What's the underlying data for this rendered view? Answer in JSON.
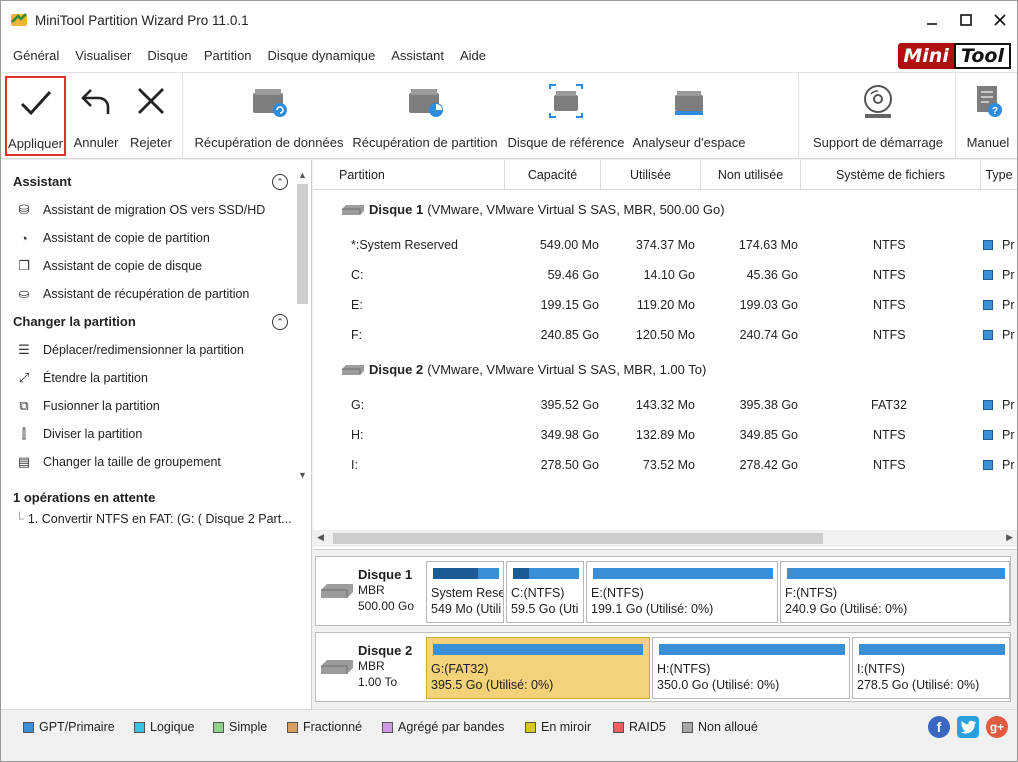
{
  "window": {
    "title": "MiniTool Partition Wizard Pro 11.0.1"
  },
  "logo": {
    "part1": "Mini",
    "part2": "Tool"
  },
  "menu": [
    "Général",
    "Visualiser",
    "Disque",
    "Partition",
    "Disque dynamique",
    "Assistant",
    "Aide"
  ],
  "toolbar": {
    "apply": "Appliquer",
    "undo": "Annuler",
    "discard": "Rejeter",
    "data_recovery": "Récupération de données",
    "partition_recovery": "Récupération de partition",
    "benchmark": "Disque de référence",
    "space_analyzer": "Analyseur d'espace",
    "bootable_media": "Support de démarrage",
    "manual": "Manuel"
  },
  "sidebar": {
    "wizard_head": "Assistant",
    "wizard_items": [
      "Assistant de migration OS vers SSD/HD",
      "Assistant de copie de partition",
      "Assistant de copie de disque",
      "Assistant de récupération de partition"
    ],
    "change_head": "Changer la partition",
    "change_items": [
      "Déplacer/redimensionner la partition",
      "Étendre la partition",
      "Fusionner la partition",
      "Diviser la partition",
      "Changer la taille de groupement"
    ],
    "pending_head": "1 opérations en attente",
    "pending_items": [
      "1. Convertir NTFS en FAT: (G: ( Disque 2 Part..."
    ]
  },
  "table": {
    "columns": [
      "Partition",
      "Capacité",
      "Utilisée",
      "Non utilisée",
      "Système de fichiers",
      "Type"
    ],
    "disk1": {
      "name": "Disque 1",
      "desc": "(VMware, VMware Virtual S SAS, MBR, 500.00 Go)"
    },
    "disk1_rows": [
      {
        "partition": "*:System Reserved",
        "capacity": "549.00 Mo",
        "used": "374.37 Mo",
        "unused": "174.63 Mo",
        "fs": "NTFS",
        "type": "Pr"
      },
      {
        "partition": "C:",
        "capacity": "59.46 Go",
        "used": "14.10 Go",
        "unused": "45.36 Go",
        "fs": "NTFS",
        "type": "Pr"
      },
      {
        "partition": "E:",
        "capacity": "199.15 Go",
        "used": "119.20 Mo",
        "unused": "199.03 Go",
        "fs": "NTFS",
        "type": "Pr"
      },
      {
        "partition": "F:",
        "capacity": "240.85 Go",
        "used": "120.50 Mo",
        "unused": "240.74 Go",
        "fs": "NTFS",
        "type": "Pr"
      }
    ],
    "disk2": {
      "name": "Disque 2",
      "desc": "(VMware, VMware Virtual S SAS, MBR, 1.00 To)"
    },
    "disk2_rows": [
      {
        "partition": "G:",
        "capacity": "395.52 Go",
        "used": "143.32 Mo",
        "unused": "395.38 Go",
        "fs": "FAT32",
        "type": "Pr"
      },
      {
        "partition": "H:",
        "capacity": "349.98 Go",
        "used": "132.89 Mo",
        "unused": "349.85 Go",
        "fs": "NTFS",
        "type": "Pr"
      },
      {
        "partition": "I:",
        "capacity": "278.50 Go",
        "used": "73.52 Mo",
        "unused": "278.42 Go",
        "fs": "NTFS",
        "type": "Pr"
      }
    ]
  },
  "diskmap": {
    "disk1": {
      "name": "Disque 1",
      "type": "MBR",
      "size": "500.00 Go",
      "parts": [
        {
          "l1": "System Rese",
          "l2": "549 Mo (Utili",
          "used": 0.68
        },
        {
          "l1": "C:(NTFS)",
          "l2": "59.5 Go (Uti",
          "used": 0.24
        },
        {
          "l1": "E:(NTFS)",
          "l2": "199.1 Go (Utilisé: 0%)",
          "used": 0.0
        },
        {
          "l1": "F:(NTFS)",
          "l2": "240.9 Go (Utilisé: 0%)",
          "used": 0.0
        }
      ]
    },
    "disk2": {
      "name": "Disque 2",
      "type": "MBR",
      "size": "1.00 To",
      "parts": [
        {
          "l1": "G:(FAT32)",
          "l2": "395.5 Go (Utilisé: 0%)",
          "used": 0.0
        },
        {
          "l1": "H:(NTFS)",
          "l2": "350.0 Go (Utilisé: 0%)",
          "used": 0.0
        },
        {
          "l1": "I:(NTFS)",
          "l2": "278.5 Go (Utilisé: 0%)",
          "used": 0.0
        }
      ]
    }
  },
  "legend": [
    {
      "label": "GPT/Primaire",
      "color": "#3b8fd6"
    },
    {
      "label": "Logique",
      "color": "#38c3e0"
    },
    {
      "label": "Simple",
      "color": "#8fd08f"
    },
    {
      "label": "Fractionné",
      "color": "#d8a060"
    },
    {
      "label": "Agrégé par bandes",
      "color": "#d098e0"
    },
    {
      "label": "En miroir",
      "color": "#d8c818"
    },
    {
      "label": "RAID5",
      "color": "#f06060"
    },
    {
      "label": "Non alloué",
      "color": "#a8a8a8"
    }
  ],
  "colors": {
    "accent": "#3b8fd6",
    "selected_row": "#8f8f8f",
    "selected_partition": "#f3d27a",
    "apply_highlight": "#e0302d"
  }
}
